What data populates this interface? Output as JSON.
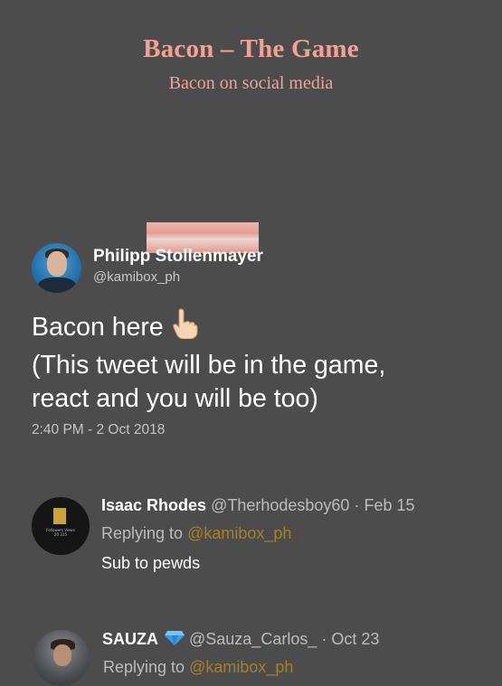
{
  "header": {
    "title": "Bacon – The Game",
    "subtitle": "Bacon on social media"
  },
  "tweet": {
    "author_name": "Philipp Stollenmayer",
    "author_handle": "@kamibox_ph",
    "text_line1": "Bacon here",
    "text_line2": "(This tweet will be in the game,",
    "text_line3": "react and you will be too)",
    "emoji": "pointing-hand-icon",
    "timestamp": "2:40 PM - 2 Oct 2018"
  },
  "replies": [
    {
      "name": "Isaac Rhodes",
      "handle": "@Therhodesboy60",
      "date": "· Feb 15",
      "replying_label": "Replying to",
      "replying_to": "@kamibox_ph",
      "text": "Sub to pewds",
      "avatar_text": "Followers  Views  20  315"
    },
    {
      "name": "SAUZA",
      "badge_icon": "blue-diamond-icon",
      "handle": "@Sauza_Carlos_",
      "date": "· Oct 23",
      "replying_label": "Replying to",
      "replying_to": "@kamibox_ph"
    }
  ],
  "colors": {
    "background": "#4c4c4c",
    "header_text": "#f3a195",
    "mention": "#a77f29",
    "tape": "#f0a498"
  }
}
